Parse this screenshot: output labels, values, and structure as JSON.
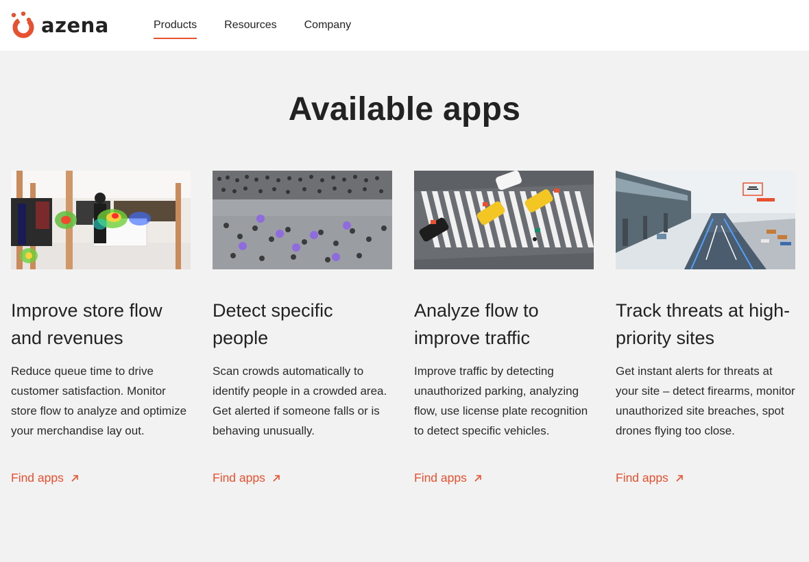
{
  "brand": {
    "name": "azena",
    "accent": "#e8512f"
  },
  "nav": {
    "items": [
      {
        "label": "Products",
        "active": true
      },
      {
        "label": "Resources",
        "active": false
      },
      {
        "label": "Company",
        "active": false
      }
    ]
  },
  "page": {
    "heading": "Available apps"
  },
  "cards": [
    {
      "image": "store-heatmap-image",
      "title": "Improve store flow and revenues",
      "text": "Reduce queue time to drive customer satisfaction. Monitor store flow to analyze and optimize your merchandise lay out.",
      "link": "Find apps"
    },
    {
      "image": "crowd-detection-image",
      "title": "Detect specific people",
      "text": "Scan crowds automatically to identify people in a crowded area. Get alerted if someone falls or is behaving unusually.",
      "link": "Find apps"
    },
    {
      "image": "traffic-crosswalk-image",
      "title": "Analyze flow to improve traffic",
      "text": "Improve traffic by detecting unauthorized parking, analyzing flow, use license plate recognition to detect specific vehicles.",
      "link": "Find apps"
    },
    {
      "image": "airport-runway-image",
      "title": "Track threats at high-priority sites",
      "text": "Get instant alerts for threats at your site – detect firearms, monitor unauthorized site breaches, spot drones flying too close.",
      "link": "Find apps"
    }
  ]
}
